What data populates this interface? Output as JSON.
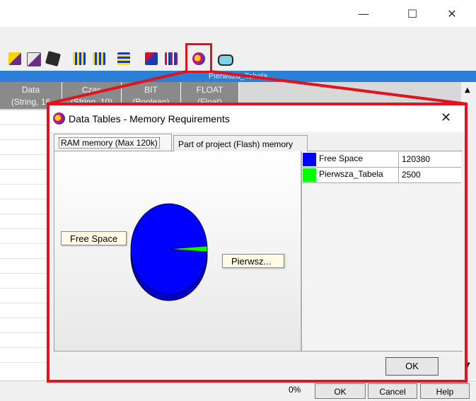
{
  "window": {
    "minimize_glyph": "—",
    "maximize_glyph": "☐",
    "close_glyph": "✕"
  },
  "toolbar": {
    "icons": [
      "insert-row-icon",
      "insert-column-icon",
      "delete-icon",
      "table-icon",
      "table-edit-icon",
      "table-view-icon",
      "table-check-icon",
      "grid-color-icon",
      "memory-requirements-icon",
      "find-icon"
    ]
  },
  "table_tab": {
    "title": "Pierwsza_Tabela"
  },
  "grid": {
    "columns": [
      {
        "line1": "Data",
        "line2": "(String, 16"
      },
      {
        "line1": "Czas",
        "line2": "(String, 10)"
      },
      {
        "line1": "BIT",
        "line2": "(Boolean)"
      },
      {
        "line1": "FLOAT",
        "line2": "(Float)"
      }
    ]
  },
  "status_bar": {
    "percent": "0%",
    "ok_label": "OK",
    "cancel_label": "Cancel",
    "help_label": "Help"
  },
  "dialog": {
    "title": "Data Tables - Memory Requirements",
    "close_glyph": "✕",
    "tabs": [
      {
        "label": "RAM memory (Max 120k)",
        "active": true
      },
      {
        "label": "Part of project (Flash) memory",
        "active": false
      }
    ],
    "callouts": {
      "left": "Free Space",
      "right": "Pierwsz..."
    },
    "ok_label": "OK"
  },
  "chart_data": {
    "type": "pie",
    "slices": [
      {
        "label": "Free Space",
        "value": 120380,
        "color": "#0000ff"
      },
      {
        "label": "Pierwsza_Tabela",
        "value": 2500,
        "color": "#00ff00"
      }
    ],
    "legend_placement": "right"
  },
  "colors": {
    "highlight": "#e0141e",
    "tab_bar": "#2a7fd6"
  }
}
